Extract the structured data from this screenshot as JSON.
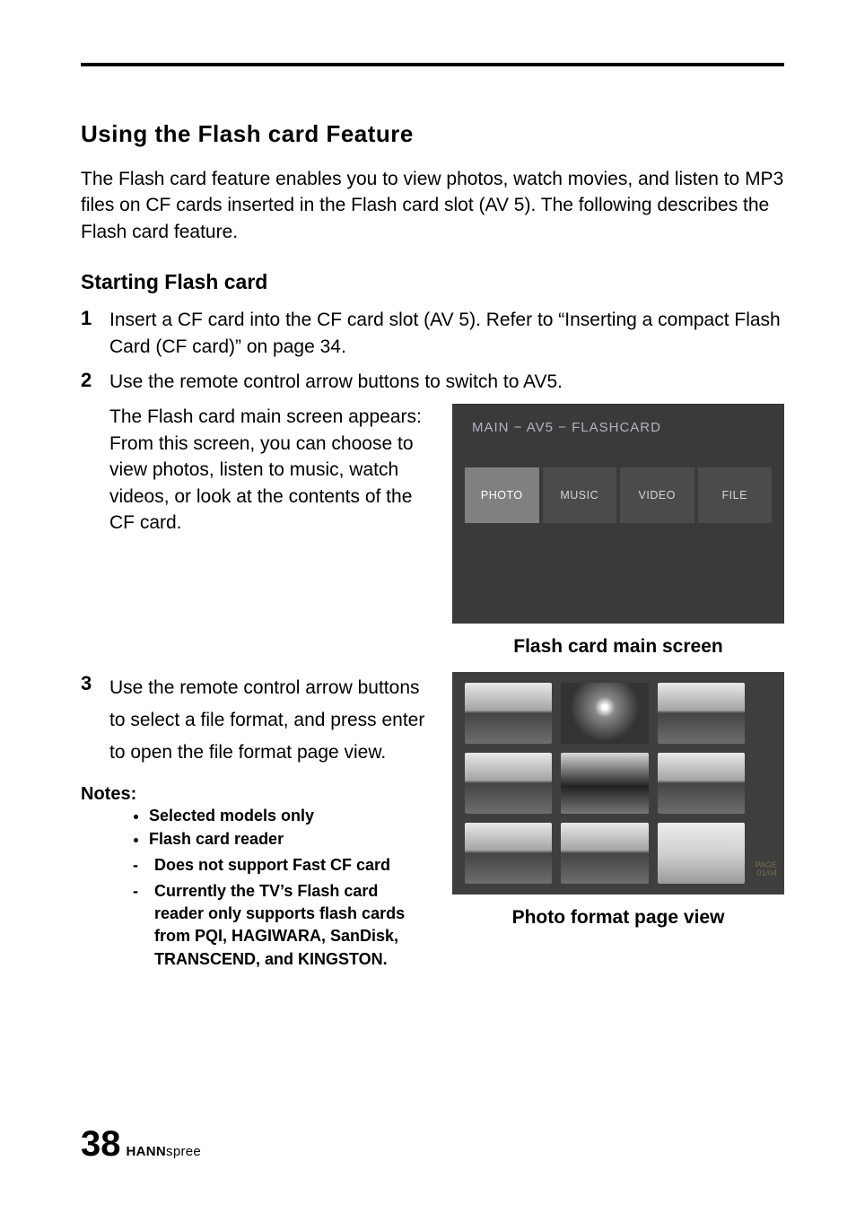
{
  "section_title": "Using the Flash card Feature",
  "intro": "The Flash card feature enables you to view photos, watch movies, and listen to MP3 files on CF cards inserted in the Flash card slot (AV 5). The following describes the Flash card feature.",
  "sub_title": "Starting Flash card",
  "steps": {
    "s1": {
      "num": "1",
      "text": "Insert a CF card into the CF card slot (AV 5). Refer to “Inserting a compact Flash Card (CF card)” on page 34."
    },
    "s2": {
      "num": "2",
      "text": "Use the remote control arrow buttons to switch to AV5."
    },
    "s2_detail": "The Flash card main screen appears:\nFrom this screen, you can choose to view photos, listen to music, watch videos, or look at the contents of the CF card.",
    "s3": {
      "num": "3",
      "text": "Use the remote control arrow buttons to select a file format, and press enter to open the file format page view."
    }
  },
  "mock_main": {
    "breadcrumb": "MAIN  −  AV5 − FLASHCARD",
    "tiles": [
      "PHOTO",
      "MUSIC",
      "VIDEO",
      "FILE"
    ],
    "caption": "Flash card main screen"
  },
  "photo_view": {
    "page_label_1": "PAGE",
    "page_label_2": "01/04",
    "caption": "Photo format page view"
  },
  "notes": {
    "label": "Notes:",
    "b1": "Selected models only",
    "b2": "Flash card reader",
    "sub1": "Does not support Fast CF card",
    "sub2": "Currently the TV’s Flash card reader only supports flash cards from PQI, HAGIWARA, SanDisk, TRANSCEND, and KINGSTON."
  },
  "footer": {
    "page": "38",
    "brand_bold": "HANN",
    "brand_thin": "spree"
  }
}
